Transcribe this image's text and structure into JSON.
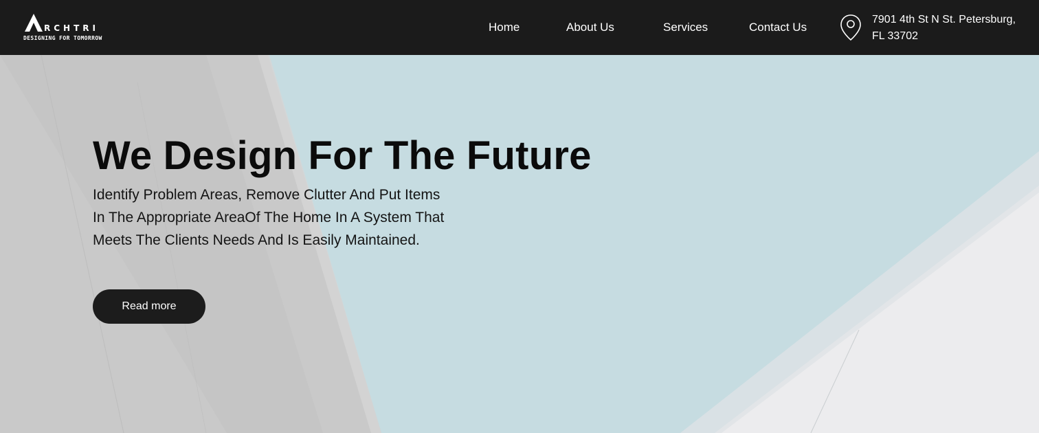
{
  "brand": {
    "name": "RCHTRI",
    "initial": "A",
    "tagline": "DESIGNING FOR TOMORROW"
  },
  "nav": {
    "items": [
      {
        "label": "Home"
      },
      {
        "label": "About Us"
      },
      {
        "label": "Services"
      },
      {
        "label": "Contact Us"
      }
    ]
  },
  "address": {
    "line1": "7901 4th St N St. Petersburg,",
    "line2": "FL 33702",
    "icon": "location-pin-icon"
  },
  "hero": {
    "title": "We Design For The Future",
    "description_lines": [
      "Identify Problem Areas, Remove Clutter And Put Items",
      "In The Appropriate AreaOf The Home In A System That",
      "Meets The Clients Needs And Is Easily Maintained."
    ],
    "button_label": "Read more"
  },
  "colors": {
    "header_bg": "#1b1b1b",
    "sky": "#c6dce1",
    "button_bg": "#1c1c1c"
  }
}
